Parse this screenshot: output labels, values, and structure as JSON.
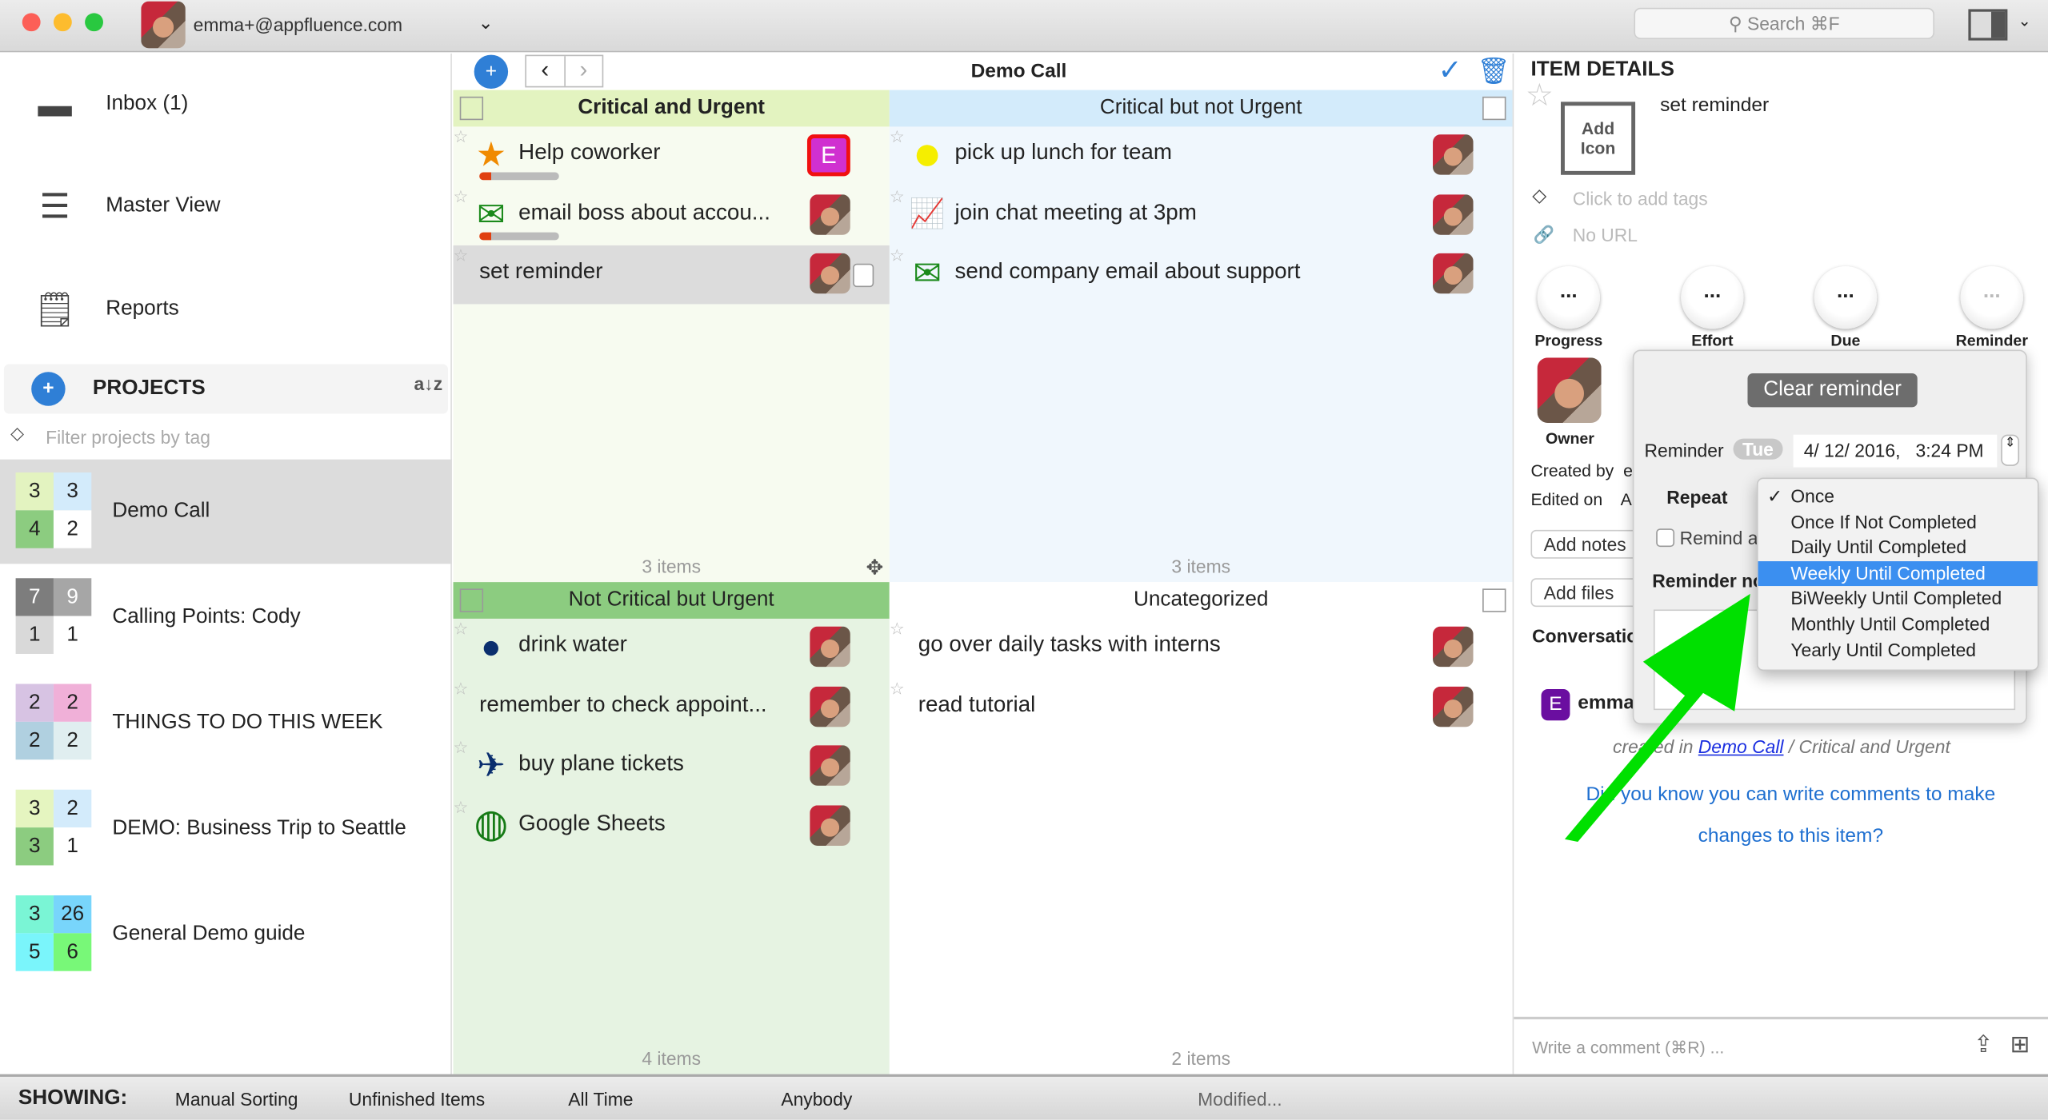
{
  "titlebar": {
    "account": "emma+@appfluence.com",
    "search_placeholder": "Search ⌘F"
  },
  "sidebar": {
    "nav": [
      {
        "label": "Inbox (1)",
        "icon": "inbox-icon"
      },
      {
        "label": "Master View",
        "icon": "list-icon"
      },
      {
        "label": "Reports",
        "icon": "report-icon"
      }
    ],
    "projects_label": "PROJECTS",
    "filter_placeholder": "Filter projects by tag",
    "projects": [
      {
        "name": "Demo Call",
        "counts": [
          "3",
          "3",
          "4",
          "2"
        ],
        "colors": [
          "#e3f3c0",
          "#d3ebfb",
          "#8ccc80",
          "#ffffff"
        ],
        "selected": true
      },
      {
        "name": "Calling Points: Cody",
        "counts": [
          "7",
          "9",
          "1",
          "1"
        ],
        "colors": [
          "#7d7d7d",
          "#a6a6a6",
          "#d9d9d9",
          "#ffffff"
        ]
      },
      {
        "name": "THINGS TO DO THIS WEEK",
        "counts": [
          "2",
          "2",
          "2",
          "2"
        ],
        "colors": [
          "#d7c3e3",
          "#f0b0d8",
          "#b0d0e0",
          "#e0eef0"
        ]
      },
      {
        "name": "DEMO: Business Trip to Seattle",
        "counts": [
          "3",
          "2",
          "3",
          "1"
        ],
        "colors": [
          "#e5f5c0",
          "#d3ebfb",
          "#8ccc80",
          "#ffffff"
        ]
      },
      {
        "name": "General Demo guide",
        "counts": [
          "3",
          "26",
          "5",
          "6"
        ],
        "colors": [
          "#7af5d5",
          "#78d5fb",
          "#7af5fb",
          "#78f878"
        ]
      }
    ]
  },
  "center": {
    "title": "Demo Call",
    "quadrants": [
      {
        "title": "Critical and Urgent",
        "count": "3 items",
        "tasks": [
          {
            "name": "Help coworker",
            "icon": "soon-star-icon",
            "owner": "E"
          },
          {
            "name": "email boss about accou...",
            "icon": "envelope-icon"
          },
          {
            "name": "set reminder",
            "selected": true
          }
        ]
      },
      {
        "title": "Critical but not Urgent",
        "count": "3 items",
        "tasks": [
          {
            "name": "pick up lunch for team",
            "icon": "yellow-circle-icon"
          },
          {
            "name": "join chat meeting at 3pm",
            "icon": "chart-icon"
          },
          {
            "name": "send company email about support",
            "icon": "envelope-icon"
          }
        ]
      },
      {
        "title": "Not Critical but Urgent",
        "count": "4 items",
        "tasks": [
          {
            "name": "drink water",
            "icon": "apple-icon"
          },
          {
            "name": "remember to check appoint..."
          },
          {
            "name": "buy plane tickets",
            "icon": "plane-icon"
          },
          {
            "name": "Google Sheets",
            "icon": "globe-icon"
          }
        ]
      },
      {
        "title": "Uncategorized",
        "count": "2 items",
        "tasks": [
          {
            "name": "go over daily tasks with interns"
          },
          {
            "name": "read tutorial"
          }
        ]
      }
    ]
  },
  "details": {
    "heading": "ITEM DETAILS",
    "add_icon": "Add Icon",
    "item_name": "set reminder",
    "tags_placeholder": "Click to add tags",
    "url": "No URL",
    "circles": [
      {
        "label": "Progress",
        "value": "..."
      },
      {
        "label": "Effort",
        "value": "..."
      },
      {
        "label": "Due",
        "value": "..."
      },
      {
        "label": "Reminder",
        "value": "..."
      }
    ],
    "owner_label": "Owner",
    "created_by": "Created by  e",
    "edited_on": "Edited on    A",
    "add_notes": "Add notes",
    "add_files": "Add files",
    "conversation": "Conversation",
    "comment_user": "emma",
    "comment_initial": "E",
    "created_prefix": "created in ",
    "created_link": "Demo Call",
    "created_suffix": " / Critical and Urgent",
    "tip_line1": "Did you know you can write comments to make",
    "tip_line2": "changes to this item?",
    "comment_placeholder": "Write a comment (⌘R) ..."
  },
  "popover": {
    "clear": "Clear reminder",
    "reminder_label": "Reminder",
    "day": "Tue",
    "date": "4/ 12/ 2016,   3:24 PM",
    "repeat_label": "Repeat",
    "remind_label": "Remind a",
    "notes_label": "Reminder no",
    "options": [
      "Once",
      "Once If Not Completed",
      "Daily Until Completed",
      "Weekly Until Completed",
      "BiWeekly Until Completed",
      "Monthly Until Completed",
      "Yearly Until Completed"
    ],
    "checked": "Once",
    "highlighted": "Weekly Until Completed"
  },
  "bottom": {
    "showing": "SHOWING:",
    "sorting": "Manual Sorting",
    "items": "Unfinished Items",
    "time": "All Time",
    "who": "Anybody",
    "modified": "Modified..."
  },
  "colors": {
    "accent": "#2f7fd6",
    "q1": "#e3f3c0",
    "q2": "#d3ebfb",
    "q3": "#8ccc80",
    "arrow": "#00e000",
    "highlight": "#3b8ff0"
  }
}
